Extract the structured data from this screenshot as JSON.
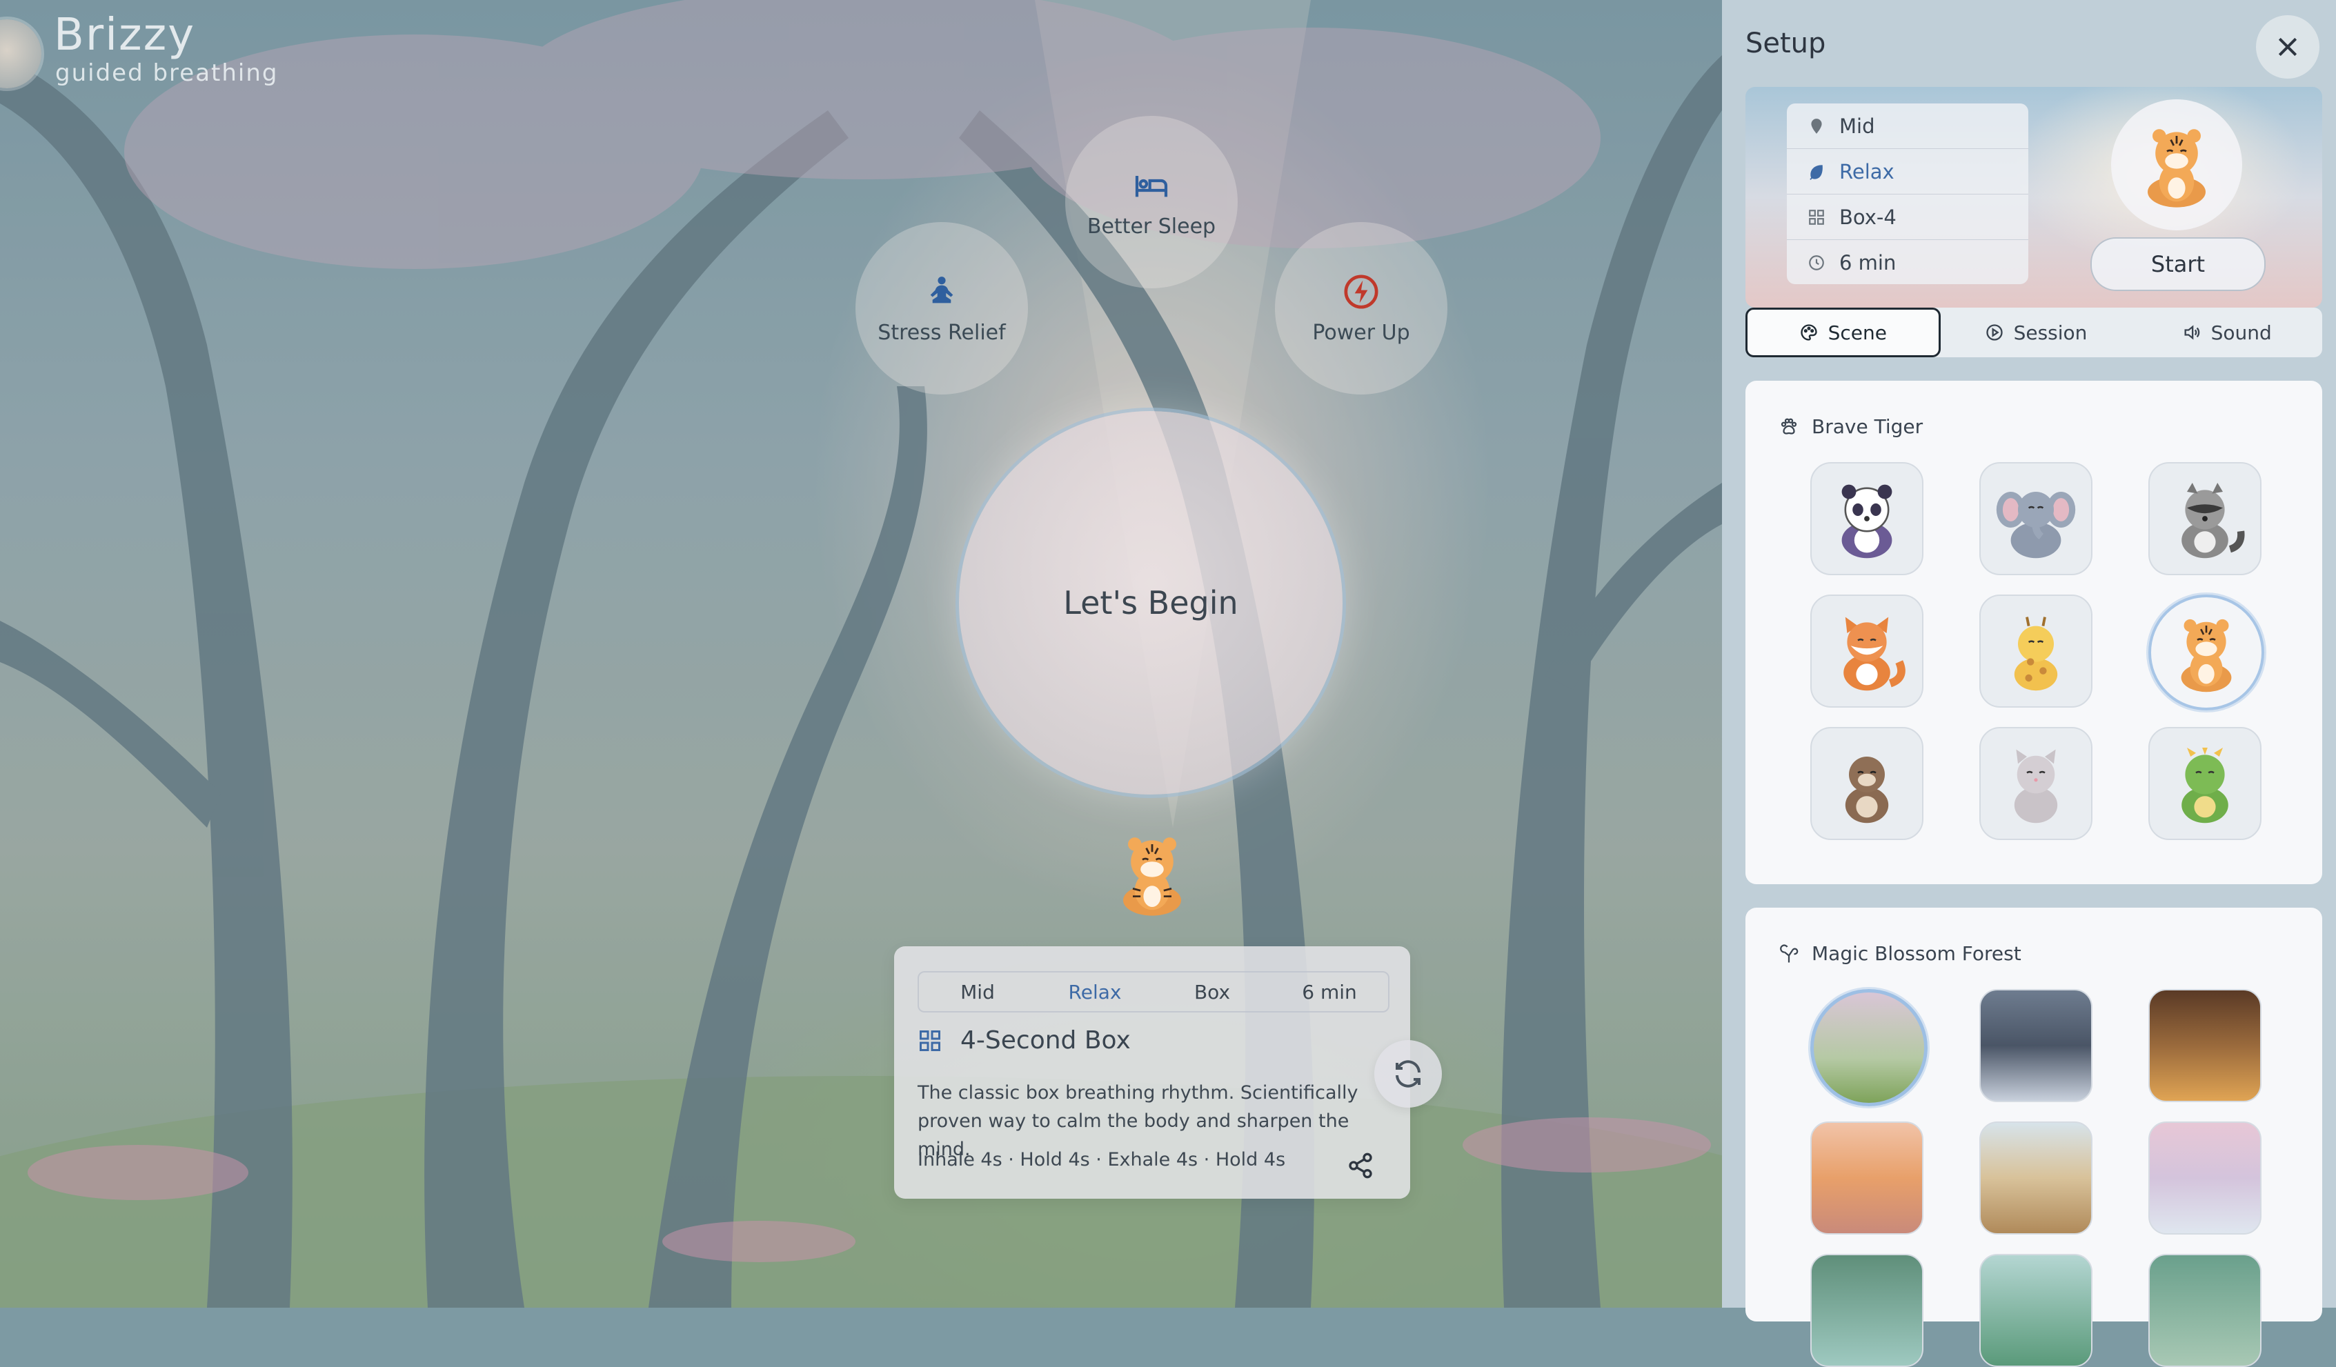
{
  "brand": {
    "name": "Brizzy",
    "tagline": "guided breathing"
  },
  "modes": [
    {
      "label": "Better Sleep",
      "icon": "bed-icon"
    },
    {
      "label": "Stress Relief",
      "icon": "meditation-icon"
    },
    {
      "label": "Power Up",
      "icon": "lightning-icon"
    }
  ],
  "begin_label": "Let's Begin",
  "card": {
    "tabs": [
      "Mid",
      "Relax",
      "Box",
      "6 min"
    ],
    "active_tab": "Relax",
    "title": "4-Second Box",
    "description": "The classic box breathing rhythm. Scientifically proven way to calm the body and sharpen the mind.",
    "pattern": "Inhale 4s · Hold 4s · Exhale 4s · Hold 4s"
  },
  "panel": {
    "title": "Setup",
    "summary": [
      {
        "label": "Mid",
        "icon": "location-icon"
      },
      {
        "label": "Relax",
        "icon": "leaf-icon",
        "active": true
      },
      {
        "label": "Box-4",
        "icon": "grid-icon"
      },
      {
        "label": "6 min",
        "icon": "timer-icon"
      }
    ],
    "start_label": "Start",
    "tabs": [
      {
        "label": "Scene",
        "icon": "palette-icon",
        "active": true
      },
      {
        "label": "Session",
        "icon": "play-icon"
      },
      {
        "label": "Sound",
        "icon": "speaker-icon"
      }
    ],
    "character_section": {
      "title": "Brave Tiger",
      "characters": [
        "panda",
        "elephant",
        "raccoon",
        "fox",
        "giraffe",
        "tiger",
        "otter",
        "cat",
        "dragon"
      ],
      "selected": "tiger"
    },
    "scene_section": {
      "title": "Magic Blossom Forest",
      "scenes": [
        "blossom-forest",
        "city-street",
        "grand-hall",
        "desert-sunset",
        "beach-sand",
        "snow-bubbles",
        "tropical-lake",
        "green-mountains",
        "jungle-bridge"
      ],
      "selected": "blossom-forest"
    }
  },
  "colors": {
    "accent": "#3d6aa6",
    "power": "#c0392b",
    "panel": "#c6d4dc"
  }
}
